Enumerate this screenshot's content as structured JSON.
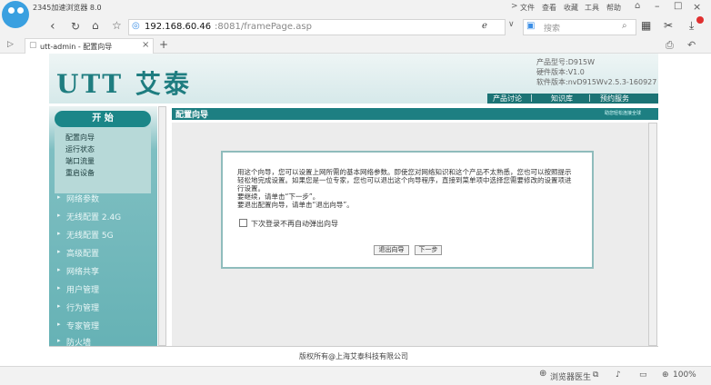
{
  "browser": {
    "title": "2345加速浏览器 8.0",
    "menu": [
      "文件",
      "查看",
      "收藏",
      "工具",
      "帮助"
    ],
    "url_host": "192.168.60.46",
    "url_rest": ":8081/framePage.asp",
    "search_placeholder": "搜索",
    "tab_title": "utt-admin - 配置向导",
    "tab_close": "×",
    "new_tab": "+"
  },
  "banner": {
    "logo": "UTT 艾泰",
    "product_model": "产品型号:D915W",
    "hardware_version": "硬件版本:V1.0",
    "software_version": "软件版本:nvD915Wv2.5.3-160927",
    "nav": [
      "产品讨论",
      "知识库",
      "预约服务"
    ]
  },
  "sidebar": {
    "start_label": "开 始",
    "sub_items": [
      "配置向导",
      "运行状态",
      "端口流量",
      "重启设备"
    ],
    "menu_items": [
      "网络参数",
      "无线配置 2.4G",
      "无线配置 5G",
      "高级配置",
      "网络共享",
      "用户管理",
      "行为管理",
      "专家管理",
      "防火墙"
    ]
  },
  "main": {
    "title": "配置向导",
    "header_right": "助您轻松连接全球",
    "dialog_lines": [
      "用这个向导，您可以设置上网所需的基本网络参数。即使您对网络知识和这个产品不太熟悉，您也可以按照提示",
      "轻松地完成设置。如果您是一位专家，您也可以退出这个向导程序，直接到菜单项中选择您需要修改的设置项进",
      "行设置。",
      "要继续，请单击“下一步”。",
      "要退出配置向导，请单击“退出向导”。"
    ],
    "checkbox_label": "下次登录不再自动弹出向导",
    "exit_button": "退出向导",
    "next_button": "下一步",
    "footer": "版权所有@上海艾泰科技有限公司"
  },
  "status": {
    "doctor": "浏览器医生",
    "zoom": "100%"
  }
}
